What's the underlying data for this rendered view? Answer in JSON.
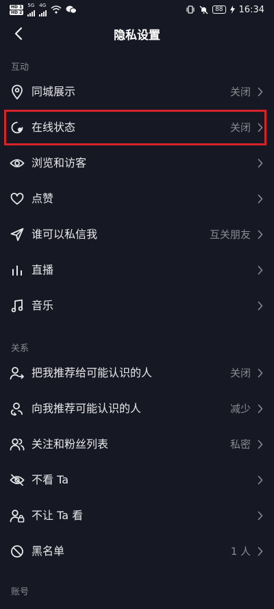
{
  "status_bar": {
    "hd1": "HD 1",
    "hd2": "HD 2",
    "net1": "5G",
    "net2": "4G",
    "battery": "88",
    "time": "16:34"
  },
  "header": {
    "title": "隐私设置"
  },
  "sections": {
    "interaction": {
      "title": "互动",
      "items": [
        {
          "label": "同城展示",
          "value": "关闭",
          "icon": "location-pin-icon"
        },
        {
          "label": "在线状态",
          "value": "关闭",
          "icon": "online-status-icon"
        },
        {
          "label": "浏览和访客",
          "value": "",
          "icon": "eye-icon"
        },
        {
          "label": "点赞",
          "value": "",
          "icon": "heart-icon"
        },
        {
          "label": "谁可以私信我",
          "value": "互关朋友",
          "icon": "paper-plane-icon"
        },
        {
          "label": "直播",
          "value": "",
          "icon": "live-bars-icon"
        },
        {
          "label": "音乐",
          "value": "",
          "icon": "music-note-icon"
        }
      ]
    },
    "relations": {
      "title": "关系",
      "items": [
        {
          "label": "把我推荐给可能认识的人",
          "value": "关闭",
          "icon": "user-share-icon"
        },
        {
          "label": "向我推荐可能认识的人",
          "value": "减少",
          "icon": "user-suggest-icon"
        },
        {
          "label": "关注和粉丝列表",
          "value": "私密",
          "icon": "users-icon"
        },
        {
          "label": "不看 Ta",
          "value": "",
          "icon": "eye-off-icon"
        },
        {
          "label": "不让 Ta 看",
          "value": "",
          "icon": "user-lock-icon"
        },
        {
          "label": "黑名单",
          "value": "1 人",
          "icon": "block-icon"
        }
      ]
    },
    "account": {
      "title": "账号"
    }
  },
  "colors": {
    "background": "#161823",
    "text_primary": "#e9e9ec",
    "text_secondary": "#8a8b91",
    "highlight": "#d8232a"
  }
}
